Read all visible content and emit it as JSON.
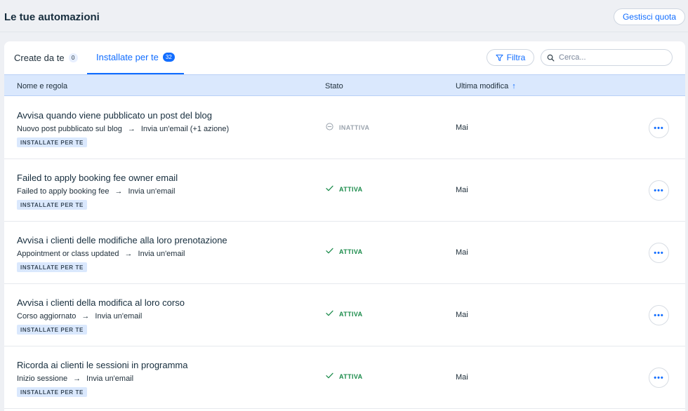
{
  "header": {
    "title": "Le tue automazioni",
    "quota_button": "Gestisci quota"
  },
  "tabs": [
    {
      "label": "Create da te",
      "count": "0"
    },
    {
      "label": "Installate per te",
      "count": "32"
    }
  ],
  "toolbar": {
    "filter_label": "Filtra",
    "search_placeholder": "Cerca..."
  },
  "table": {
    "columns": {
      "name": "Nome e regola",
      "status": "Stato",
      "modified": "Ultima modifica"
    },
    "rows": [
      {
        "title": "Avvisa quando viene pubblicato un post del blog",
        "trigger": "Nuovo post pubblicato sul blog",
        "action": "Invia un'email (+1 azione)",
        "badge": "INSTALLATE PER TE",
        "status": "INATTIVA",
        "modified": "Mai"
      },
      {
        "title": "Failed to apply booking fee owner email",
        "trigger": "Failed to apply booking fee",
        "action": "Invia un'email",
        "badge": "INSTALLATE PER TE",
        "status": "ATTIVA",
        "modified": "Mai"
      },
      {
        "title": "Avvisa i clienti delle modifiche alla loro prenotazione",
        "trigger": "Appointment or class updated",
        "action": "Invia un'email",
        "badge": "INSTALLATE PER TE",
        "status": "ATTIVA",
        "modified": "Mai"
      },
      {
        "title": "Avvisa i clienti della modifica al loro corso",
        "trigger": "Corso aggiornato",
        "action": "Invia un'email",
        "badge": "INSTALLATE PER TE",
        "status": "ATTIVA",
        "modified": "Mai"
      },
      {
        "title": "Ricorda ai clienti le sessioni in programma",
        "trigger": "Inizio sessione",
        "action": "Invia un'email",
        "badge": "INSTALLATE PER TE",
        "status": "ATTIVA",
        "modified": "Mai"
      }
    ]
  },
  "icons": {
    "filter": "filter-icon",
    "search": "search-icon",
    "sort": "arrow-up-icon",
    "active": "check-icon",
    "inactive": "minus-circle-icon",
    "menu": "more-horizontal-icon"
  },
  "colors": {
    "accent": "#116dff",
    "active": "#1a8b4a",
    "inactive": "#9aa3ad",
    "header_bg": "#dae8fd"
  }
}
